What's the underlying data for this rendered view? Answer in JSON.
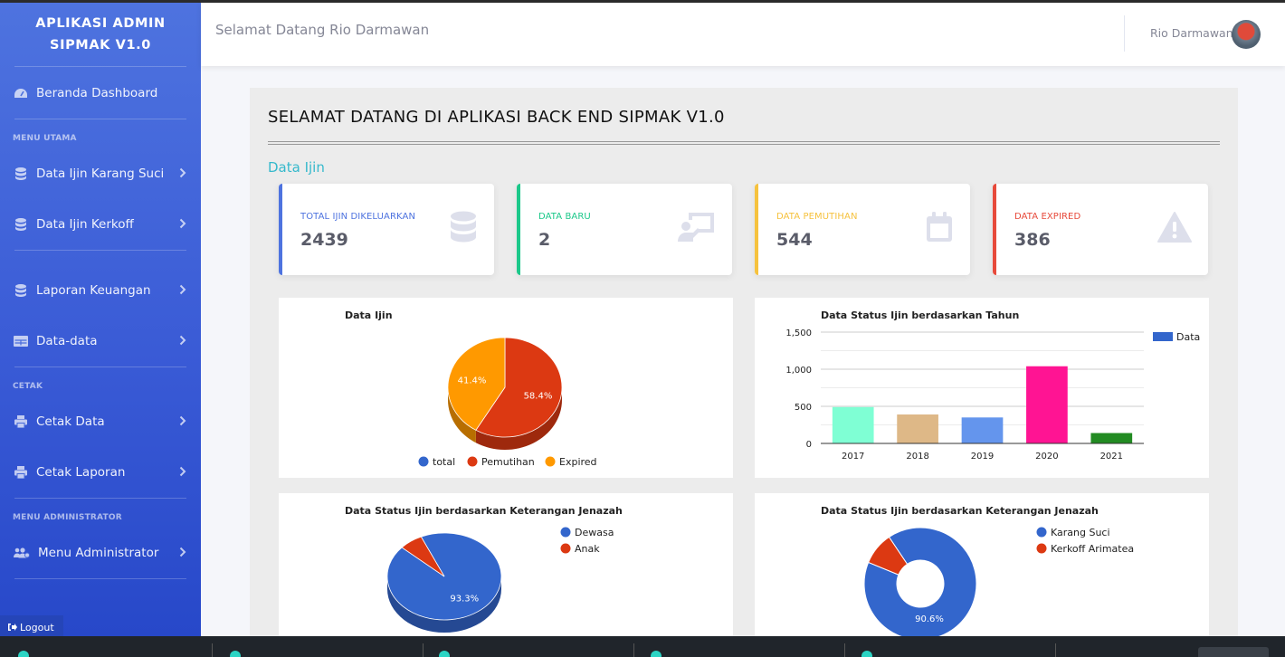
{
  "sidebar": {
    "brand_line1": "APLIKASI ADMIN",
    "brand_line2": "SIPMAK V1.0",
    "dashboard": "Beranda Dashboard",
    "section_main": "MENU UTAMA",
    "items_main": [
      "Data Ijin Karang Suci",
      "Data Ijin Kerkoff",
      "Laporan Keuangan",
      "Data-data"
    ],
    "section_print": "CETAK",
    "items_print": [
      "Cetak Data",
      "Cetak Laporan"
    ],
    "section_admin": "MENU ADMINISTRATOR",
    "admin_item": "Menu Administrator",
    "logout": "Logout"
  },
  "topbar": {
    "welcome": "Selamat Datang Rio Darmawan",
    "user_name": "Rio Darmawan"
  },
  "main": {
    "title": "SELAMAT DATANG DI APLIKASI BACK END SIPMAK V1.0",
    "section_title": "Data Ijin",
    "cards": [
      {
        "label": "TOTAL IJIN DIKELUARKAN",
        "value": "2439",
        "color": "#4e73df",
        "icon": "database-icon"
      },
      {
        "label": "DATA BARU",
        "value": "2",
        "color": "#1cc88a",
        "icon": "chalkboard-teacher-icon"
      },
      {
        "label": "DATA PEMUTIHAN",
        "value": "544",
        "color": "#f6c23e",
        "icon": "calendar-icon"
      },
      {
        "label": "DATA EXPIRED",
        "value": "386",
        "color": "#e74a3b",
        "icon": "warning-icon"
      }
    ]
  },
  "chart_data": [
    {
      "type": "pie",
      "title": "Data Ijin",
      "labels": [
        "total",
        "Pemutihan",
        "Expired"
      ],
      "values": [
        0,
        58.4,
        41.4
      ],
      "slice_labels": [
        "",
        "58.4%",
        "41.4%"
      ],
      "colors": [
        "#3366cc",
        "#dc3912",
        "#ff9900"
      ],
      "legend": "bottom"
    },
    {
      "type": "bar",
      "title": "Data Status Ijin berdasarkan Tahun",
      "categories": [
        "2017",
        "2018",
        "2019",
        "2020",
        "2021"
      ],
      "series": [
        {
          "name": "Data",
          "values": [
            490,
            390,
            350,
            1040,
            140
          ]
        }
      ],
      "bar_colors": [
        "#7fffd4",
        "#deb887",
        "#6495ed",
        "#ff1493",
        "#228b22"
      ],
      "ylim": [
        0,
        1500
      ],
      "yticks": [
        "0",
        "500",
        "1,000",
        "1,500"
      ],
      "legend": "right"
    },
    {
      "type": "pie",
      "title": "Data Status Ijin berdasarkan Keterangan Jenazah",
      "labels": [
        "Dewasa",
        "Anak"
      ],
      "values": [
        93.3,
        6.7
      ],
      "slice_labels": [
        "93.3%",
        ""
      ],
      "colors": [
        "#3366cc",
        "#dc3912"
      ],
      "legend": "right"
    },
    {
      "type": "pie",
      "title": "Data Status Ijin berdasarkan Keterangan Jenazah",
      "labels": [
        "Karang Suci",
        "Kerkoff Arimatea"
      ],
      "values": [
        90.6,
        9.4
      ],
      "slice_labels": [
        "90.6%",
        ""
      ],
      "colors": [
        "#3366cc",
        "#dc3912"
      ],
      "donut": true,
      "legend": "right"
    }
  ]
}
